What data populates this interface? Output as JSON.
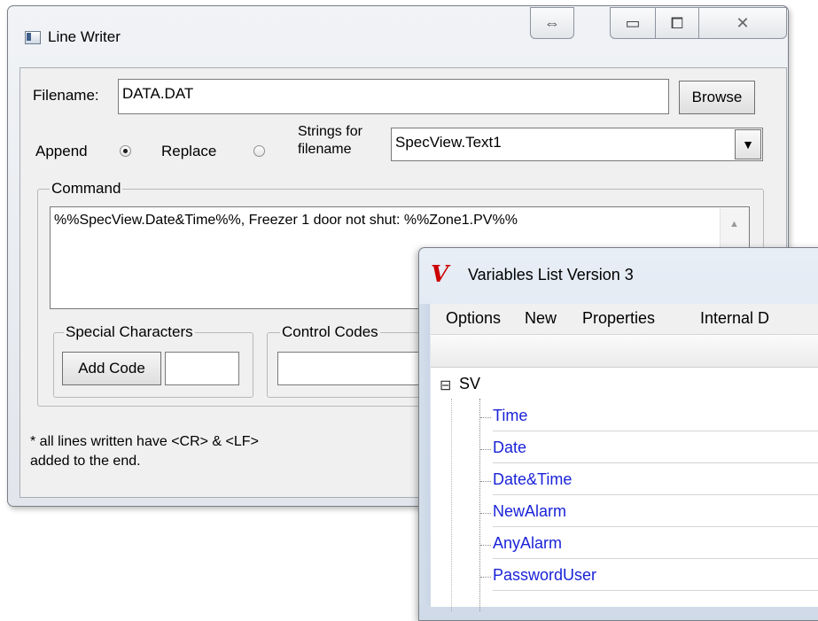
{
  "line_writer": {
    "title": "Line Writer",
    "filename_label": "Filename:",
    "filename_value": "DATA.DAT",
    "browse_label": "Browse",
    "append_label": "Append",
    "replace_label": "Replace",
    "strings_label_1": "Strings for",
    "strings_label_2": "filename",
    "strings_value": "SpecView.Text1",
    "command_group_label": "Command",
    "command_text": "%%SpecView.Date&Time%%, Freezer 1 door not shut: %%Zone1.PV%%",
    "special_group_label": "Special Characters",
    "add_code_label": "Add Code",
    "control_group_label": "Control Codes",
    "note_line_1": "* all lines written have <CR> & <LF>",
    "note_line_2": "added to the end.",
    "icons": {
      "resize": "⇔",
      "minimize": "▭",
      "maximize": "⧠",
      "close": "✕",
      "dropdown": "▼",
      "scroll_up": "▲"
    }
  },
  "variables_list": {
    "title": "Variables List Version 3",
    "logo_glyph": "V",
    "menu": [
      "Options",
      "New",
      "Properties",
      "Internal D"
    ],
    "tree_root": "SV",
    "tree_expander": "⊟",
    "tree_items": [
      "Time",
      "Date",
      "Date&Time",
      "NewAlarm",
      "AnyAlarm",
      "PasswordUser"
    ],
    "colors": {
      "item_text": "#1a23d8",
      "logo": "#cc0000"
    }
  }
}
